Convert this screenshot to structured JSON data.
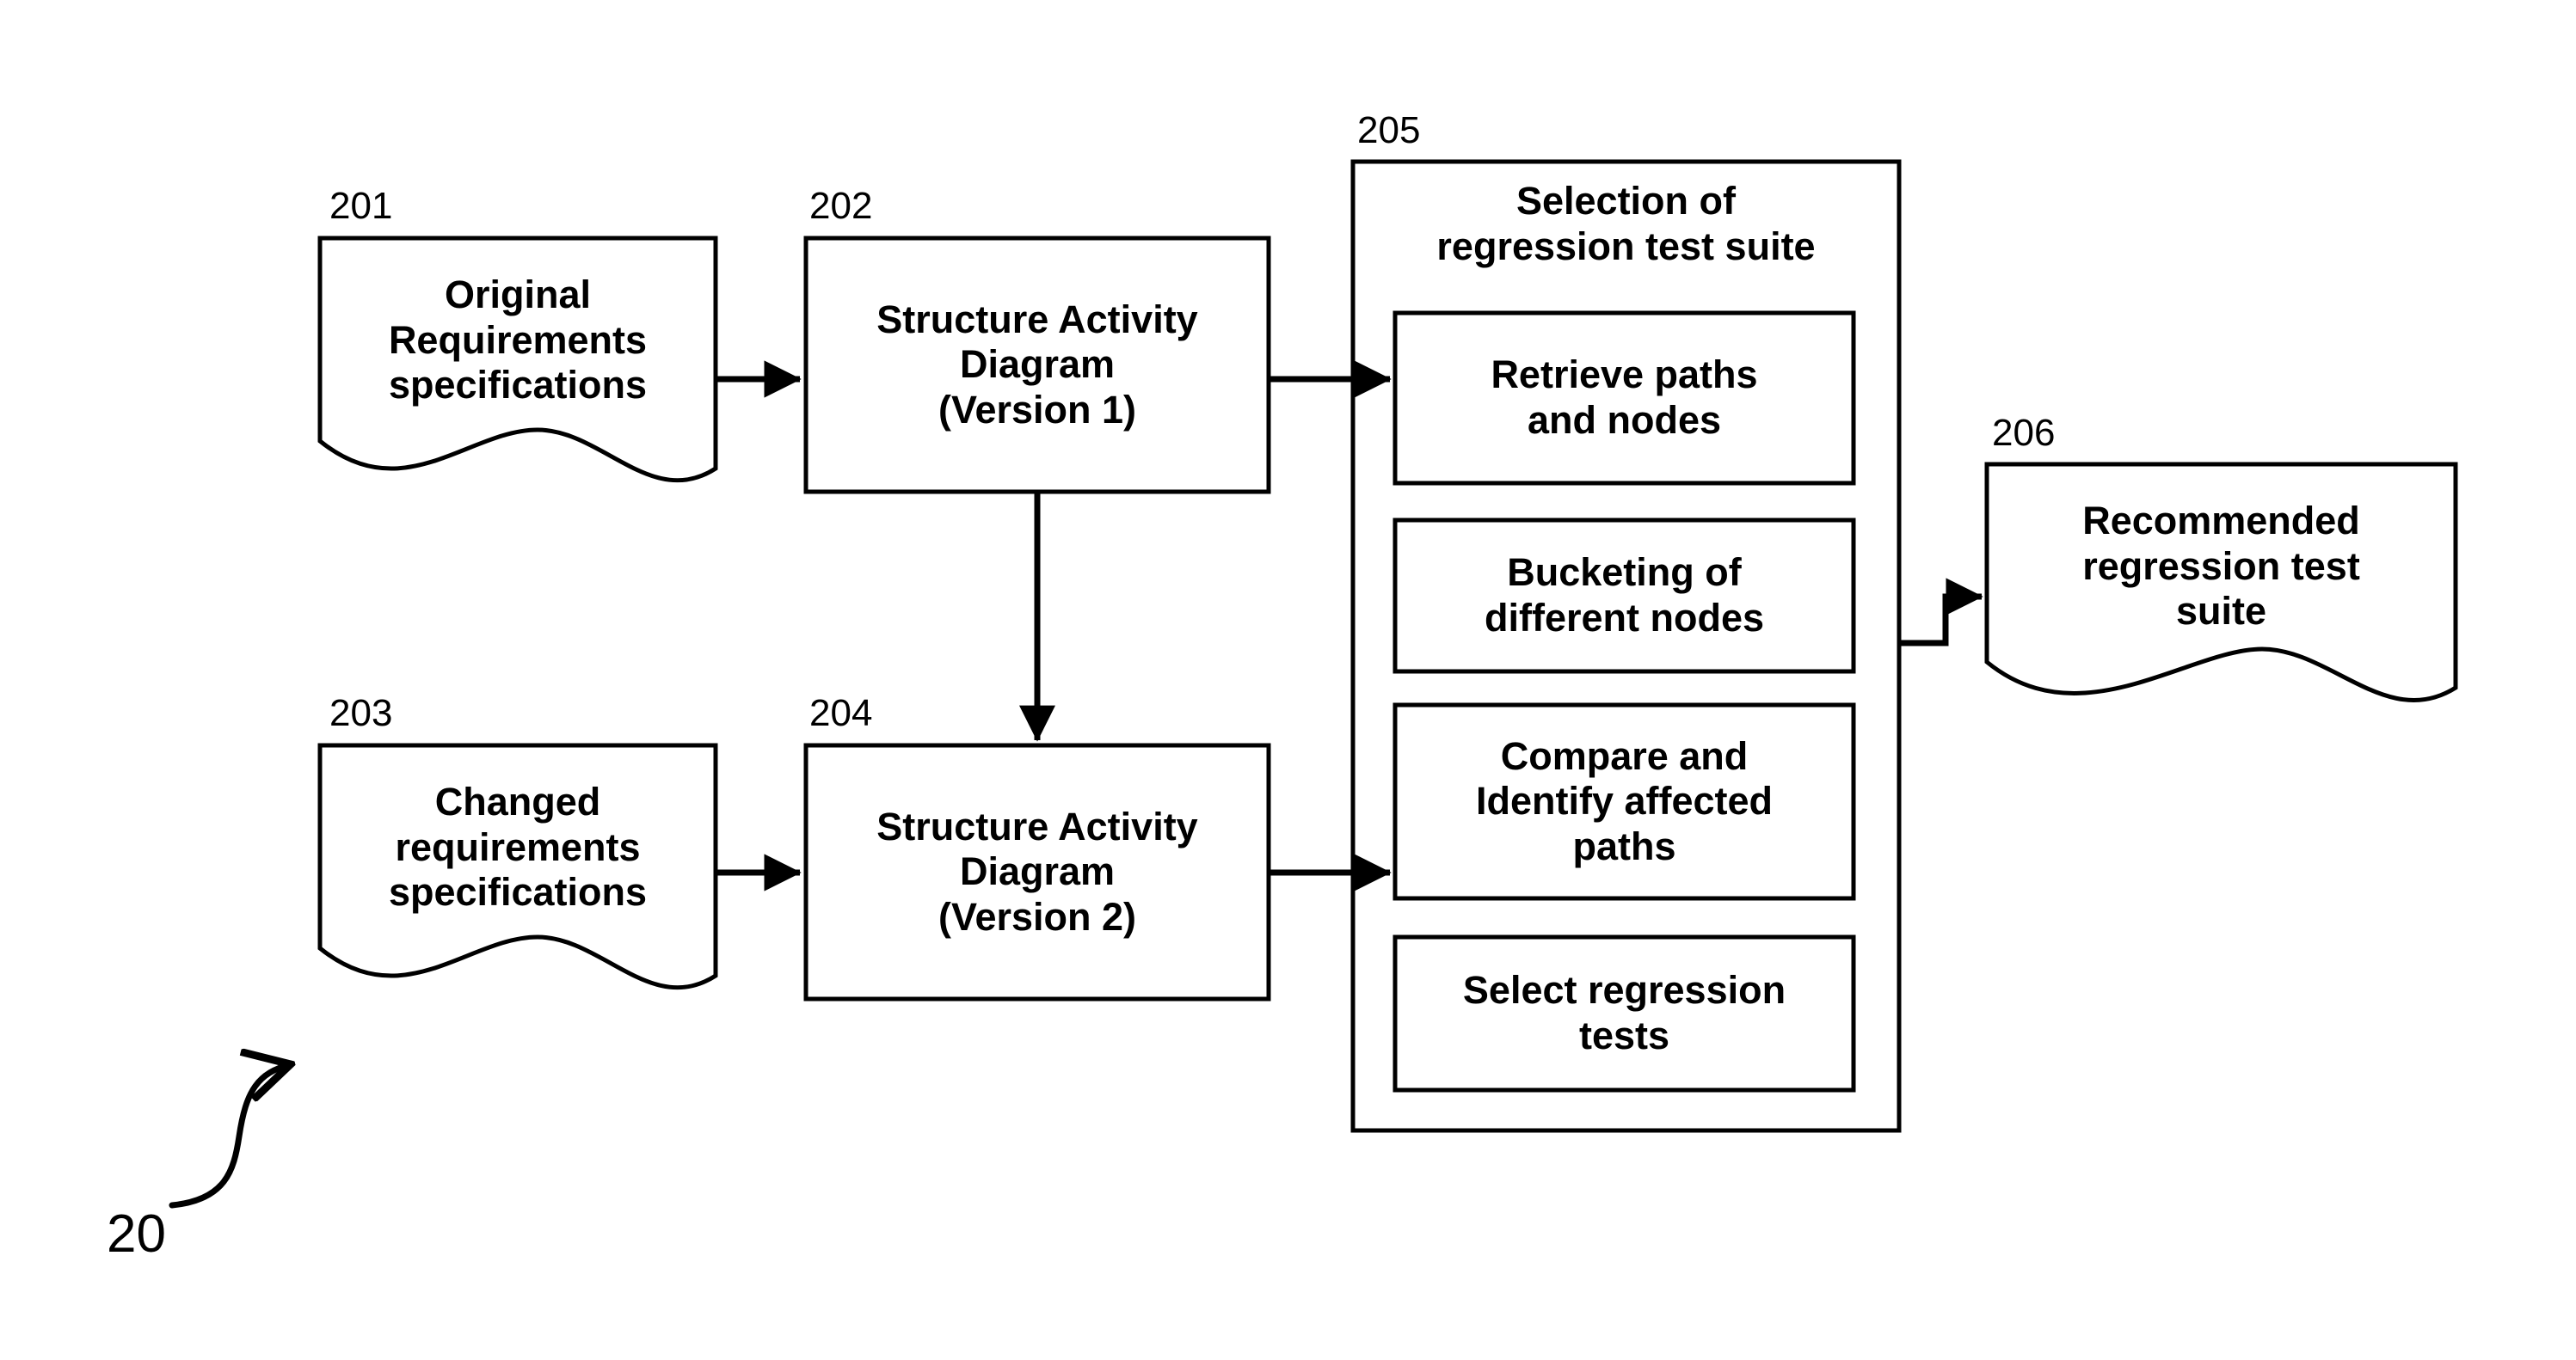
{
  "figure": {
    "number": "20",
    "background_color": "#ffffff",
    "stroke_color": "#000000"
  },
  "nodes": [
    {
      "ref": "201",
      "shape": "document",
      "label": "Original\nRequirements\nspecifications"
    },
    {
      "ref": "202",
      "shape": "rectangle",
      "label": "Structure Activity\nDiagram\n(Version 1)"
    },
    {
      "ref": "203",
      "shape": "document",
      "label": "Changed\nrequirements\nspecifications"
    },
    {
      "ref": "204",
      "shape": "rectangle",
      "label": "Structure Activity\nDiagram\n(Version 2)"
    },
    {
      "ref": "206",
      "shape": "document",
      "label": "Recommended\nregression test\nsuite"
    }
  ],
  "group": {
    "ref": "205",
    "shape": "container",
    "title": "Selection of\nregression test suite",
    "steps": [
      {
        "label": "Retrieve paths\nand nodes"
      },
      {
        "label": "Bucketing of\ndifferent nodes"
      },
      {
        "label": "Compare and\nIdentify affected\npaths"
      },
      {
        "label": "Select regression\ntests"
      }
    ]
  },
  "connectors": [
    {
      "from": "201",
      "to": "202",
      "style": "straight-arrow"
    },
    {
      "from": "202",
      "to": "205-step-1",
      "style": "straight-arrow"
    },
    {
      "from": "202",
      "to": "204",
      "style": "vertical-arrow"
    },
    {
      "from": "203",
      "to": "204",
      "style": "straight-arrow"
    },
    {
      "from": "204",
      "to": "205-step-3",
      "style": "straight-arrow"
    },
    {
      "from": "205",
      "to": "206",
      "style": "stepped-arrow"
    },
    {
      "from": "figure-label",
      "to": "diagram",
      "style": "curved-open-arrow"
    }
  ]
}
